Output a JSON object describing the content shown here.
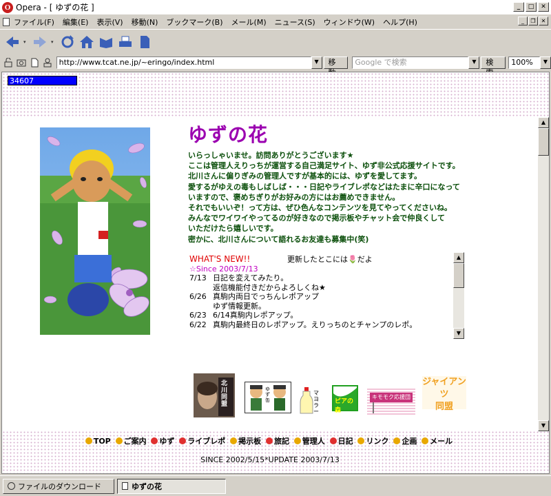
{
  "window": {
    "title": "Opera - [ ゆずの花 ]",
    "app_icon_letter": "O"
  },
  "menu": {
    "items": [
      "ファイル(F)",
      "編集(E)",
      "表示(V)",
      "移動(N)",
      "ブックマーク(B)",
      "メール(M)",
      "ニュース(S)",
      "ウィンドウ(W)",
      "ヘルプ(H)"
    ]
  },
  "address_bar": {
    "url": "http://www.tcat.ne.jp/~eringo/index.html",
    "go_label": "移動",
    "search_placeholder": "Google で検索",
    "search_label": "検索",
    "zoom": "100%"
  },
  "page": {
    "counter": "34607",
    "site_title": "ゆずの花",
    "intro_lines": [
      "いらっしゃいませ。訪問ありがとうございます★",
      "ここは管理人えりっちが運営する自己満足サイト、ゆず非公式応援サイトです。",
      "北川さんに偏りぎみの管理人ですが基本的には、ゆずを愛してます。",
      "愛するがゆえの毒もしばしば・・・日記やライブレポなどはたまに辛口になって",
      "いますので、褒めちぎりがお好みの方にはお薦めできません。",
      "それでもいいぞ！って方は、ぜひ色んなコンテンツを見てやってくださいね。",
      "みんなでワイワイやってるのが好きなので掲示板やチャット会で仲良くして",
      "いただけたら嬉しいです。",
      "密かに、北川さんについて語れるお友達も募集中(笑)"
    ],
    "news": {
      "header": "WHAT'S NEW!!",
      "update_note": "更新したとこには🌷だよ",
      "since": "☆Since 2003/7/13",
      "entries": [
        {
          "date": "7/13",
          "lines": [
            "日記を変えてみたり。",
            "返信機能付きだからよろしくね★"
          ]
        },
        {
          "date": "6/26",
          "lines": [
            "真駒内両日でっちんレポアップ",
            "ゆず情報更新。"
          ]
        },
        {
          "date": "6/23",
          "lines": [
            "6/14真駒内レポアップ。"
          ]
        },
        {
          "date": "6/22",
          "lines": [
            "真駒内最終日のレポアップ。えりっちのとチャンプのレポ。"
          ]
        }
      ]
    },
    "banners": {
      "kitagawa_text": "北川同盟",
      "yuzu_text": "ゆず缶",
      "mayo_text": "マヨラー",
      "forest_text": "ピアの森",
      "kimomoku_text": "キモモク応援団",
      "giants_line1": "ジャイアンツ",
      "giants_line2": "同盟"
    },
    "nav_links": [
      "TOP",
      "ご案内",
      "ゆず",
      "ライブレポ",
      "掲示板",
      "旅記",
      "管理人",
      "日記",
      "リンク",
      "企画",
      "メール"
    ],
    "footer": "SINCE 2002/5/15*UPDATE 2003/7/13"
  },
  "taskbar": {
    "downloads": "ファイルのダウンロード",
    "active_tab": "ゆずの花"
  },
  "colors": {
    "title_purple": "#9b00b0",
    "intro_green": "#0b4f0b",
    "news_red": "#e00000",
    "since_magenta": "#c000c0",
    "counter_blue": "#0000ff"
  }
}
